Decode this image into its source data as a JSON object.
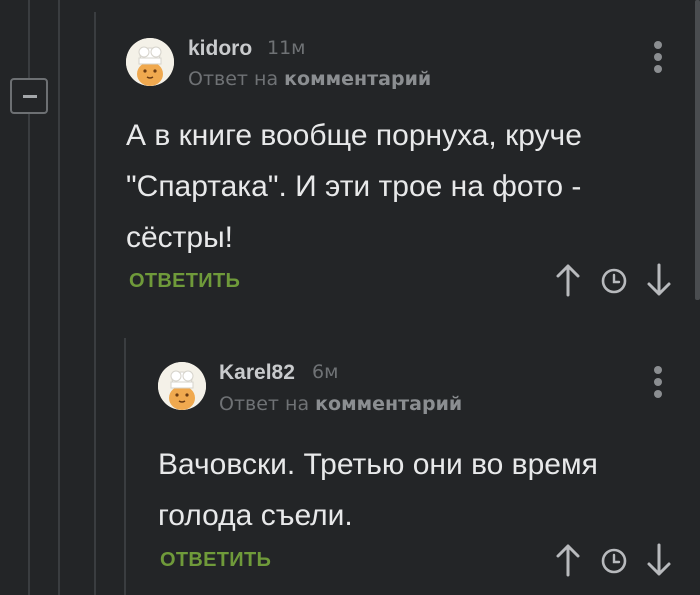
{
  "thread": {
    "collapse_icon": "minus-icon"
  },
  "comments": [
    {
      "author": "kidoro",
      "time": "11м",
      "reply_prefix": "Ответ на",
      "reply_link": "комментарий",
      "text_lines": [
        "А в книге вообще порнуха, круче",
        "\"Спартака\". И эти трое на фото -",
        "сёстры!"
      ],
      "reply_label": "ОТВЕТИТЬ",
      "avatar_icon": "chef-avatar-icon",
      "actions": [
        "upvote-icon",
        "clock-icon",
        "downvote-icon"
      ]
    },
    {
      "author": "Karel82",
      "time": "6м",
      "reply_prefix": "Ответ на",
      "reply_link": "комментарий",
      "text_lines": [
        "Вачовски. Третью они во время",
        "голода съели."
      ],
      "reply_label": "ОТВЕТИТЬ",
      "avatar_icon": "chef-avatar-icon",
      "actions": [
        "upvote-icon",
        "clock-icon",
        "downvote-icon"
      ]
    }
  ],
  "colors": {
    "background": "#232527",
    "reply_button": "#6f9a3a",
    "text": "#e8e9ea"
  }
}
